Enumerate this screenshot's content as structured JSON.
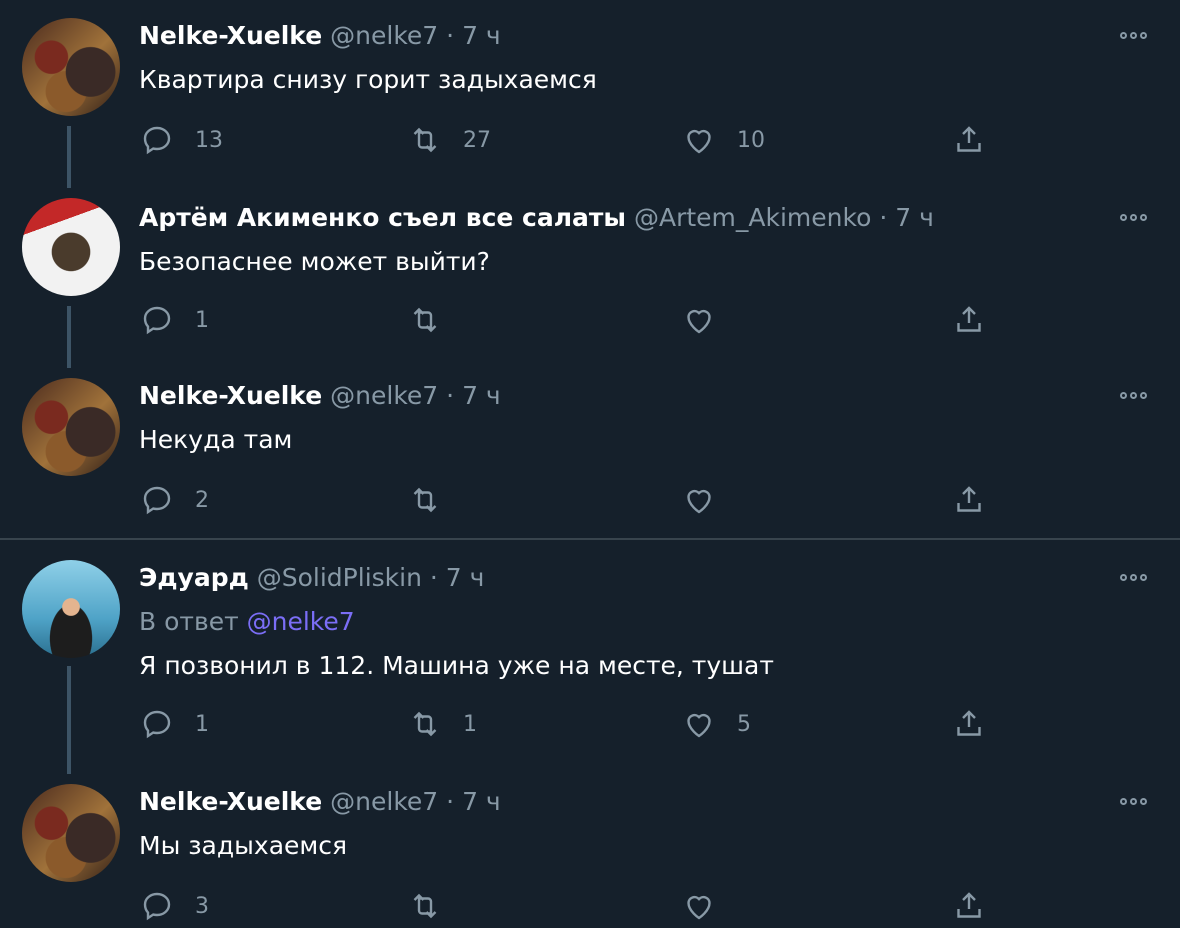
{
  "colors": {
    "background": "#15202b",
    "text": "#ffffff",
    "muted": "#8899a6",
    "mention": "#7b6ef6",
    "thread_line": "#3d5466"
  },
  "tweets": [
    {
      "name": "Nelke-Xuelke",
      "handle": "@nelke7",
      "sep": "·",
      "time": "7 ч",
      "reply_to_prefix": "",
      "reply_to_mention": "",
      "text": "Квартира снизу горит задыхаемся",
      "replies": "13",
      "retweets": "27",
      "likes": "10",
      "avatar": "nelke-avatar"
    },
    {
      "name": "Артём Акименко съел все салаты",
      "handle": "@Artem_Akimenko",
      "sep": "·",
      "time": "7 ч",
      "text": "Безопаснее может выйти?",
      "replies": "1",
      "retweets": "",
      "likes": "",
      "avatar": "artem-avatar"
    },
    {
      "name": "Nelke-Xuelke",
      "handle": "@nelke7",
      "sep": "·",
      "time": "7 ч",
      "text": "Некуда там",
      "replies": "2",
      "retweets": "",
      "likes": "",
      "avatar": "nelke-avatar"
    },
    {
      "name": "Эдуард",
      "handle": "@SolidPliskin",
      "sep": "·",
      "time": "7 ч",
      "reply_to_prefix": "В ответ",
      "reply_to_mention": "@nelke7",
      "text": "Я позвонил в 112. Машина уже на месте, тушат",
      "replies": "1",
      "retweets": "1",
      "likes": "5",
      "avatar": "eduard-avatar"
    },
    {
      "name": "Nelke-Xuelke",
      "handle": "@nelke7",
      "sep": "·",
      "time": "7 ч",
      "text": "Мы задыхаемся",
      "replies": "3",
      "retweets": "",
      "likes": "",
      "avatar": "nelke-avatar"
    }
  ]
}
